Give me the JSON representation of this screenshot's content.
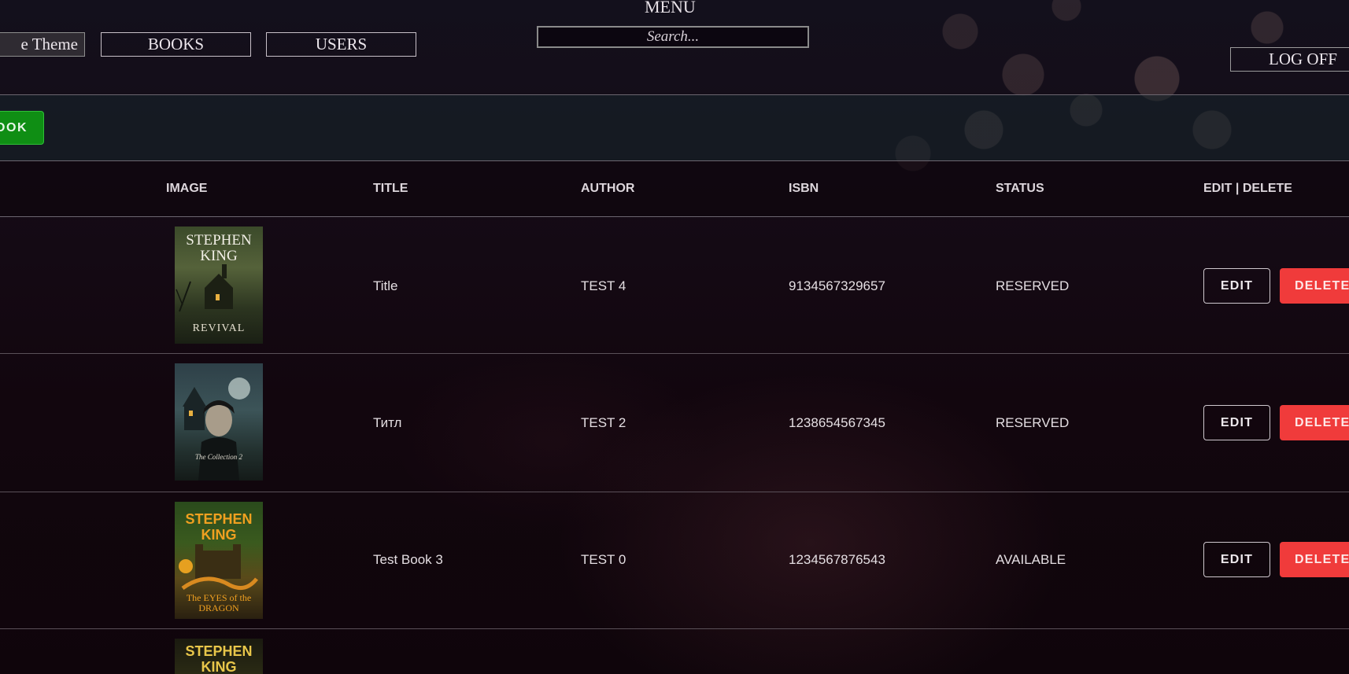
{
  "header": {
    "menu_title": "MENU",
    "search_placeholder": "Search...",
    "theme_button": "e Theme",
    "books_button": "BOOKS",
    "users_button": "USERS",
    "logoff_button": "LOG OFF"
  },
  "toolbar": {
    "add_button": "OOK",
    "add_button_color": "#0f8e14"
  },
  "table": {
    "columns": {
      "image": "IMAGE",
      "title": "TITLE",
      "author": "AUTHOR",
      "isbn": "ISBN",
      "status": "STATUS",
      "actions": "EDIT | DELETE"
    },
    "rows": [
      {
        "cover_author": "STEPHEN KING",
        "cover_title": "REVIVAL",
        "title": "Title",
        "author": "TEST 4",
        "isbn": "9134567329657",
        "status": "RESERVED",
        "edit": "EDIT",
        "delete": "DELETE"
      },
      {
        "cover_title": "The Collection 2",
        "title": "Титл",
        "author": "TEST 2",
        "isbn": "1238654567345",
        "status": "RESERVED",
        "edit": "EDIT",
        "delete": "DELETE"
      },
      {
        "cover_author": "STEPHEN KING",
        "cover_title": "The EYES of the DRAGON",
        "title": "Test Book 3",
        "author": "TEST 0",
        "isbn": "1234567876543",
        "status": "AVAILABLE",
        "edit": "EDIT",
        "delete": "DELETE"
      },
      {
        "cover_author": "STEPHEN KING"
      }
    ]
  },
  "colors": {
    "delete": "#f03b3b",
    "add": "#0f8e14",
    "background": "#12070f"
  }
}
